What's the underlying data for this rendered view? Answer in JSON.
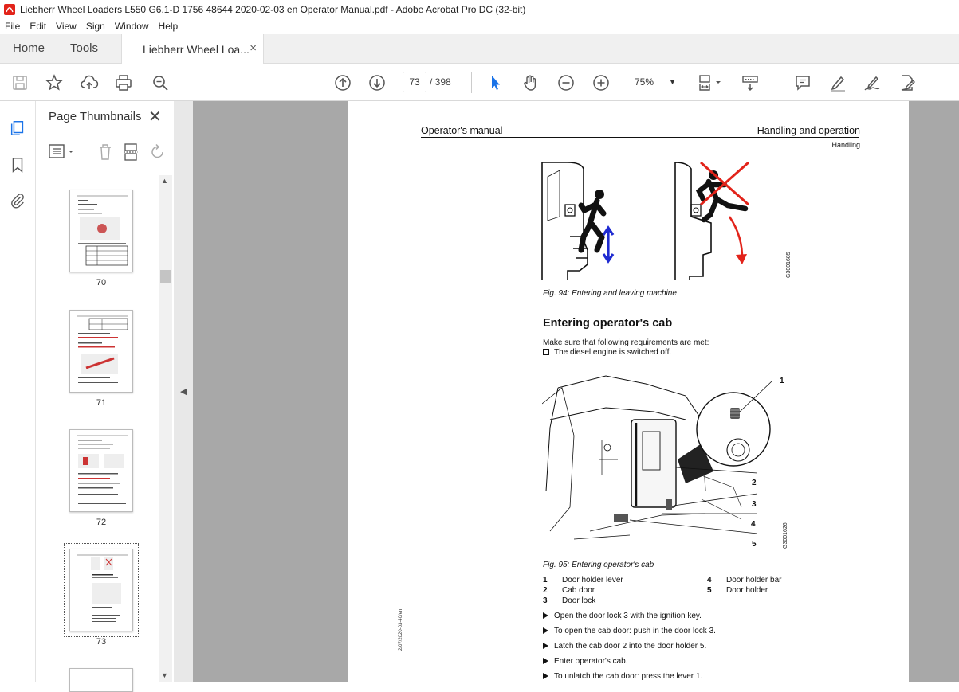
{
  "window": {
    "title": "Liebherr Wheel Loaders L550 G6.1-D 1756 48644 2020-02-03 en Operator Manual.pdf - Adobe Acrobat Pro DC (32-bit)"
  },
  "menu": {
    "items": [
      "File",
      "Edit",
      "View",
      "Sign",
      "Window",
      "Help"
    ]
  },
  "tabs": {
    "home": "Home",
    "tools": "Tools",
    "document": "Liebherr Wheel Loa...",
    "close": "×"
  },
  "toolbar": {
    "current_page": "73",
    "page_total": "/ 398",
    "zoom": "75%",
    "zoom_caret": "▼"
  },
  "thumbnails": {
    "title": "Page Thumbnails",
    "close": "✕",
    "pages": [
      {
        "label": "70"
      },
      {
        "label": "71"
      },
      {
        "label": "72"
      },
      {
        "label": "73",
        "selected": true
      }
    ]
  },
  "document": {
    "header_left": "Operator's manual",
    "header_right": "Handling and operation",
    "header_sub": "Handling",
    "fig94_caption": "Fig. 94: Entering and leaving machine",
    "fig94_code": "G3001685",
    "section_title": "Entering operator's cab",
    "intro": "Make sure that following requirements are met:",
    "requirement": "The diesel engine is switched off.",
    "fig95_caption": "Fig. 95: Entering operator's cab",
    "fig95_code": "G3001626",
    "callouts": [
      "1",
      "2",
      "3",
      "4",
      "5"
    ],
    "legend": [
      {
        "num": "1",
        "text": "Door holder lever"
      },
      {
        "num": "2",
        "text": "Cab door"
      },
      {
        "num": "3",
        "text": "Door lock"
      },
      {
        "num": "4",
        "text": "Door holder bar"
      },
      {
        "num": "5",
        "text": "Door holder"
      }
    ],
    "steps": [
      "Open the door lock 3 with the ignition key.",
      "To open the cab door: push in the door lock 3.",
      "Latch the cab door 2 into the door holder 5.",
      "Enter operator's cab.",
      "To unlatch the cab door: press the lever 1."
    ],
    "side_stamp": "2/07/2020-03-40/en"
  },
  "colors": {
    "accent_blue": "#1a73e8",
    "arrow_blue": "#1f2bd1",
    "warning_red": "#e2231a",
    "viewer_bg": "#a8a8a8"
  }
}
